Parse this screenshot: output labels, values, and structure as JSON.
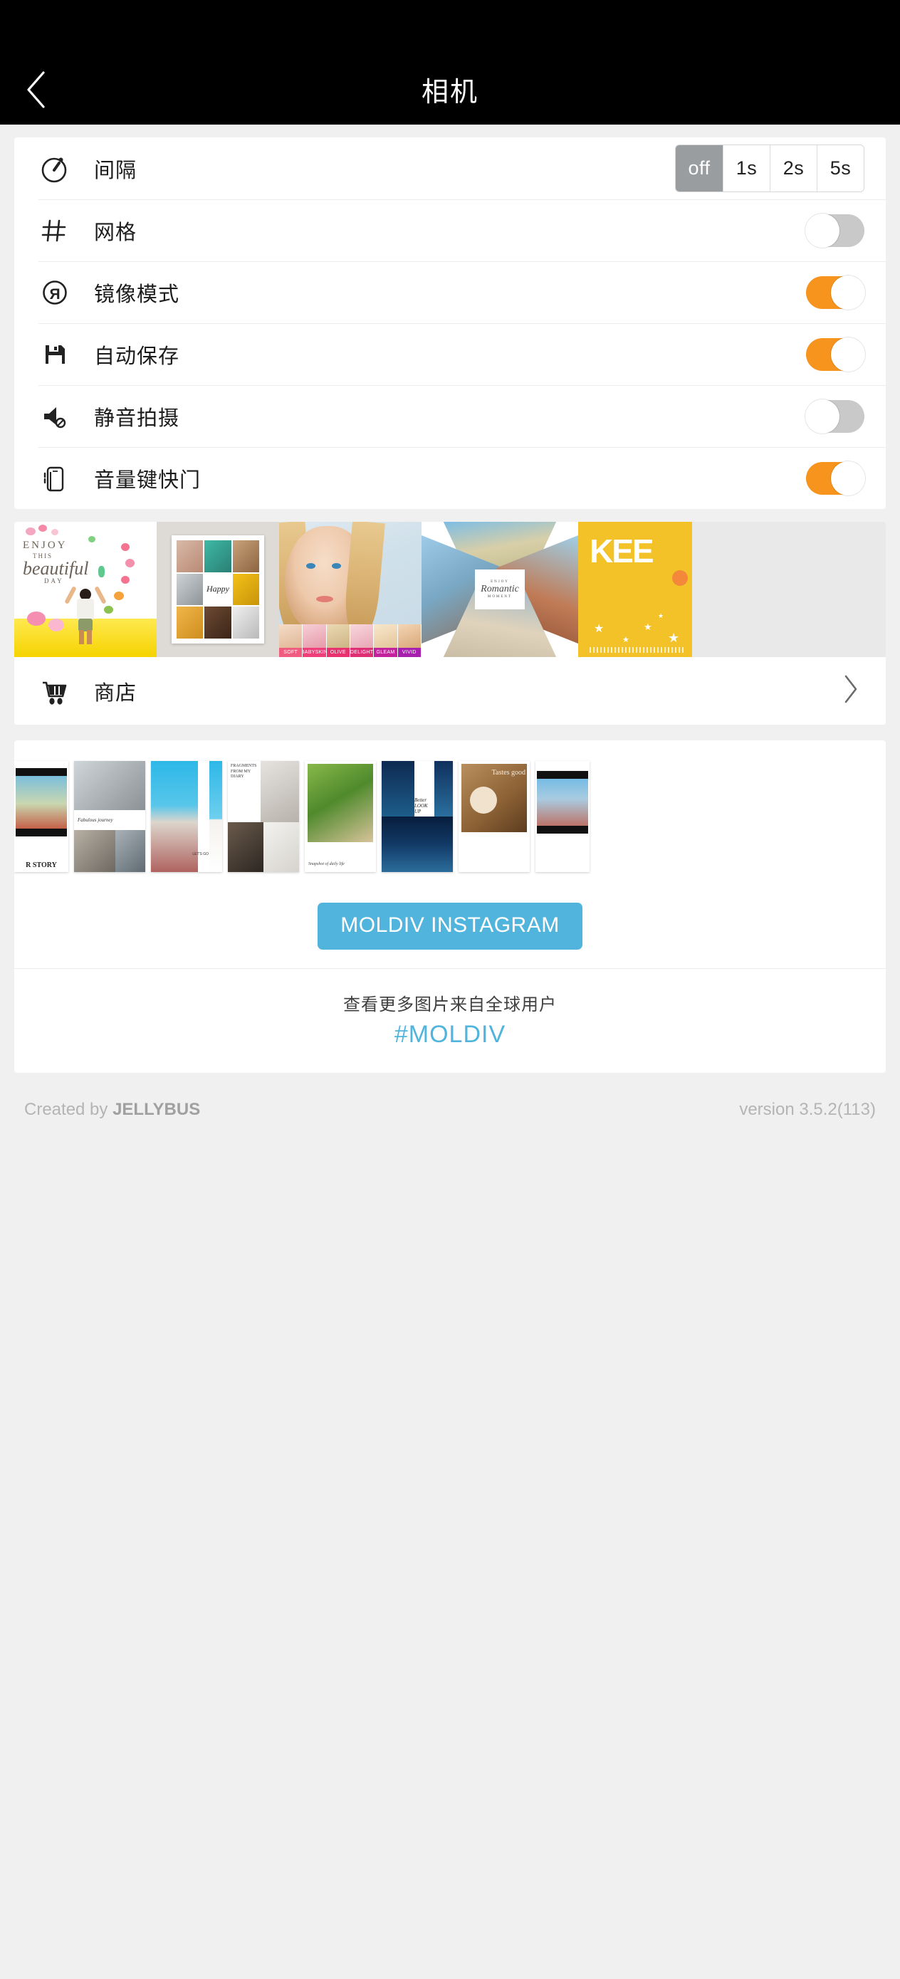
{
  "header": {
    "title": "相机",
    "back_icon": "chevron-left-icon"
  },
  "settings": {
    "interval": {
      "icon": "timer-icon",
      "label": "间隔",
      "options": [
        "off",
        "1s",
        "2s",
        "5s"
      ],
      "selected": "off"
    },
    "rows": [
      {
        "icon": "grid-icon",
        "label": "网格",
        "state": "off"
      },
      {
        "icon": "mirror-mode-icon",
        "label": "镜像模式",
        "state": "on"
      },
      {
        "icon": "floppy-save-icon",
        "label": "自动保存",
        "state": "on"
      },
      {
        "icon": "speaker-mute-icon",
        "label": "静音拍摄",
        "state": "off"
      },
      {
        "icon": "volume-key-icon",
        "label": "音量键快门",
        "state": "on"
      }
    ]
  },
  "promo": {
    "panels": [
      {
        "name": "enjoy-beautiful-day",
        "t1": "ENJOY",
        "t2": "THIS",
        "t3": "beautiful",
        "t4": "DAY"
      },
      {
        "name": "happy-collage",
        "caption": "Happy"
      },
      {
        "name": "beauty-filters",
        "filters": [
          "SOFT",
          "BABYSKIN",
          "OLIVE",
          "DELIGHT",
          "GLEAM",
          "VIVID"
        ]
      },
      {
        "name": "romantic-moment",
        "b1": "ENJOY",
        "b2": "Romantic",
        "b3": "MOMENT"
      },
      {
        "name": "keep-yellow",
        "word": "KEE"
      }
    ]
  },
  "store": {
    "icon": "shopping-cart-icon",
    "label": "商店",
    "chevron": "chevron-right-icon"
  },
  "instagram": {
    "thumbs": [
      {
        "name": "our-story-film",
        "caption": "R STORY"
      },
      {
        "name": "travel-journey",
        "caption": "Fabulous journey"
      },
      {
        "name": "beach-lets-go",
        "caption": "LET'S GO"
      },
      {
        "name": "fragments-diary",
        "caption": "FRAGMENTS FROM MY DIARY"
      },
      {
        "name": "daily-life",
        "caption": "Snapshot of daily life"
      },
      {
        "name": "city-look-up",
        "caption": "Better LOOK UP"
      },
      {
        "name": "tastes-good",
        "caption": "Tastes good"
      },
      {
        "name": "canyon-film",
        "caption": ""
      }
    ],
    "button_label": "MOLDIV INSTAGRAM",
    "footer_line1": "查看更多图片来自全球用户",
    "footer_hashtag": "#MOLDIV"
  },
  "footer": {
    "created_prefix": "Created by ",
    "created_brand": "JELLYBUS",
    "version": "version 3.5.2(113)"
  },
  "colors": {
    "accent_orange": "#f7941e",
    "accent_blue": "#51b4dd",
    "toggle_off": "#c9c9c9",
    "segment_active": "#9a9da0",
    "header_bg": "#000000",
    "page_bg": "#f0f0f0"
  }
}
